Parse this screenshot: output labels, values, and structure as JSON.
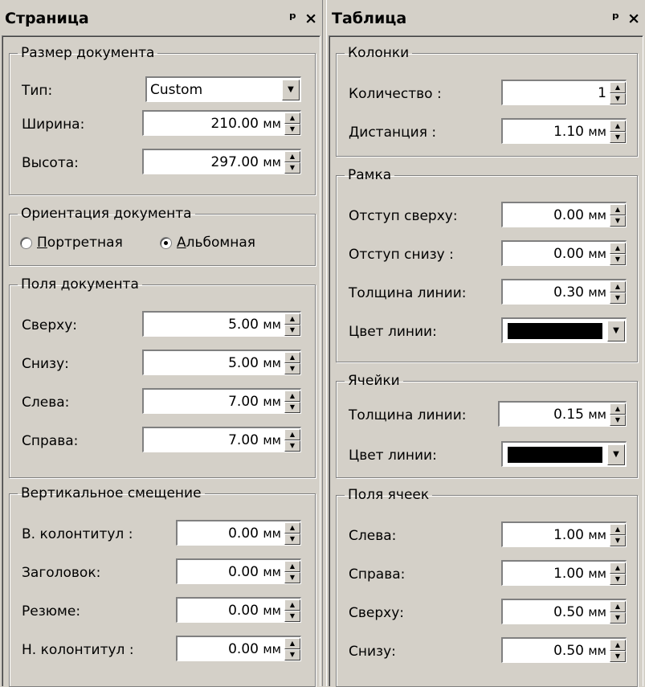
{
  "left_panel": {
    "title": "Страница",
    "pin_icon": "ф",
    "close_icon": "×",
    "doc_size": {
      "legend": "Размер документа",
      "type_label": "Тип:",
      "type_value": "Custom",
      "width_label": "Ширина:",
      "width_value": "210.00",
      "height_label": "Высота:",
      "height_value": "297.00"
    },
    "orientation": {
      "legend": "Ориентация документа",
      "portrait_hotkey": "П",
      "portrait_rest": "ортретная",
      "landscape_hotkey": "А",
      "landscape_rest": "льбомная",
      "selected": "landscape"
    },
    "margins": {
      "legend": "Поля документа",
      "top_label": "Сверху:",
      "top_value": "5.00",
      "bottom_label": "Снизу:",
      "bottom_value": "5.00",
      "left_label": "Слева:",
      "left_value": "7.00",
      "right_label": "Справа:",
      "right_value": "7.00"
    },
    "vertical_offset": {
      "legend": "Вертикальное смещение",
      "header_label": "В. колонтитул :",
      "header_value": "0.00",
      "title_label": "Заголовок:",
      "title_value": "0.00",
      "summary_label": "Резюме:",
      "summary_value": "0.00",
      "footer_label": "Н. колонтитул :",
      "footer_value": "0.00"
    }
  },
  "right_panel": {
    "title": "Таблица",
    "pin_icon": "ф",
    "close_icon": "×",
    "columns": {
      "legend": "Колонки",
      "count_label": "Количество :",
      "count_value": "1",
      "distance_label": "Дистанция :",
      "distance_value": "1.10"
    },
    "frame": {
      "legend": "Рамка",
      "top_indent_label": "Отступ сверху:",
      "top_indent_value": "0.00",
      "bottom_indent_label": "Отступ снизу :",
      "bottom_indent_value": "0.00",
      "line_width_label": "Толщина линии:",
      "line_width_value": "0.30",
      "line_color_label": "Цвет линии:",
      "line_color": "#000000"
    },
    "cells": {
      "legend": "Ячейки",
      "line_width_label": "Толщина линии:",
      "line_width_value": "0.15",
      "line_color_label": "Цвет линии:",
      "line_color": "#000000"
    },
    "cell_margins": {
      "legend": "Поля ячеек",
      "left_label": "Слева:",
      "left_value": "1.00",
      "right_label": "Справа:",
      "right_value": "1.00",
      "top_label": "Сверху:",
      "top_value": "0.50",
      "bottom_label": "Снизу:",
      "bottom_value": "0.50"
    }
  },
  "unit": "мм"
}
